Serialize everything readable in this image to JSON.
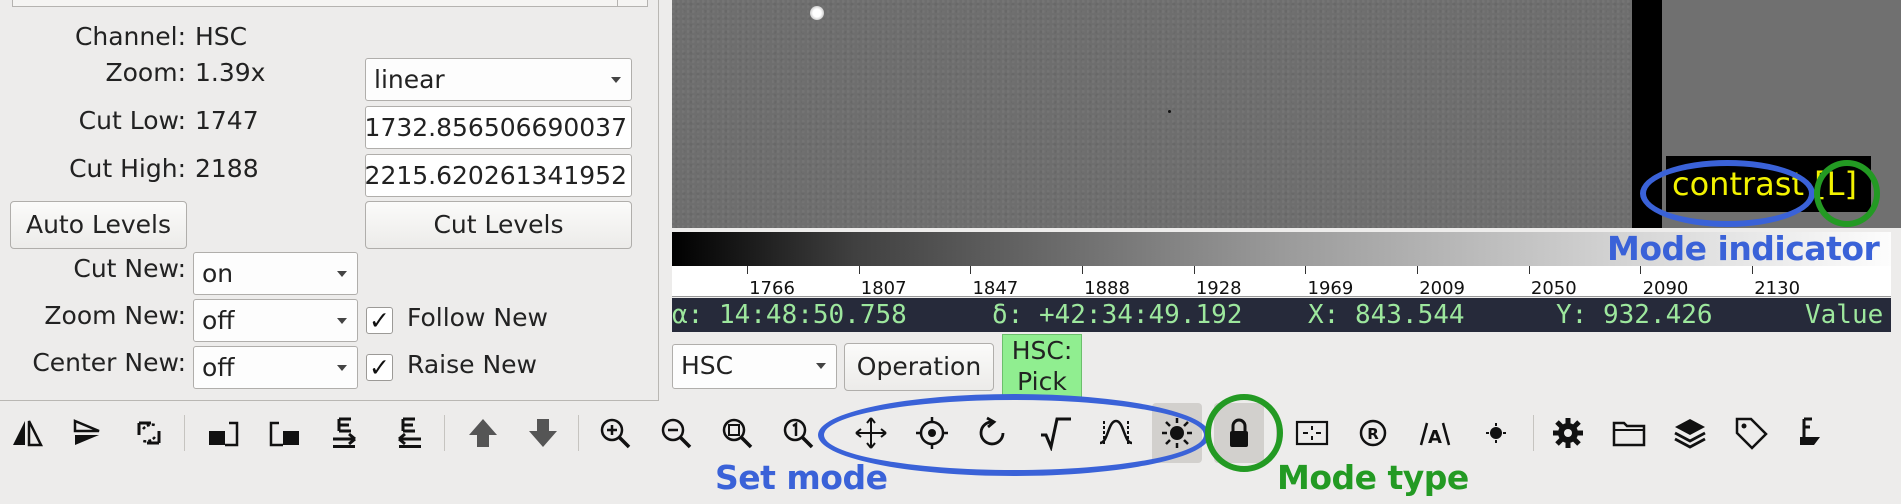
{
  "info_panel": {
    "channel_label": "Channel:",
    "channel_value": "HSC",
    "zoom_label": "Zoom:",
    "zoom_value": "1.39x",
    "zoom_mode": "linear",
    "cut_low_label": "Cut Low:",
    "cut_low_value": "1747",
    "cut_low_entry": "1732.856506690037",
    "cut_high_label": "Cut High:",
    "cut_high_value": "2188",
    "cut_high_entry": "2215.620261341952",
    "auto_levels_label": "Auto Levels",
    "cut_levels_label": "Cut Levels",
    "cut_new_label": "Cut New:",
    "cut_new_value": "on",
    "zoom_new_label": "Zoom New:",
    "zoom_new_value": "off",
    "center_new_label": "Center New:",
    "center_new_value": "off",
    "follow_new_label": "Follow New",
    "follow_new_checked": true,
    "raise_new_label": "Raise New",
    "raise_new_checked": true
  },
  "viewer": {
    "mode_name": "contrast",
    "mode_type": "[L]"
  },
  "colorbar": {
    "ticks": [
      "1766",
      "1807",
      "1847",
      "1888",
      "1928",
      "1969",
      "2009",
      "2050",
      "2090",
      "2130"
    ]
  },
  "status": {
    "ra": "α: 14:48:50.758",
    "dec": "δ: +42:34:49.192",
    "x": "X: 843.544",
    "y": "Y: 932.426",
    "value": "Value"
  },
  "channel_bar": {
    "channel": "HSC",
    "operation_label": "Operation",
    "pick_line1": "HSC:",
    "pick_line2": "Pick"
  },
  "toolbar": {
    "icons": [
      "flip-x-icon",
      "flip-y-icon",
      "swap-xy-icon",
      "rotate-90-icon",
      "rotate-neg-90-icon",
      "orient-north-icon",
      "orient-east-icon",
      "prev-image-icon",
      "next-image-icon",
      "zoom-in-icon",
      "zoom-out-icon",
      "zoom-fit-icon",
      "zoom-100-icon",
      "pan-mode-icon",
      "center-mode-icon",
      "rotate-mode-icon",
      "distribution-mode-icon",
      "cuts-mode-icon",
      "contrast-mode-icon",
      "lock-mode-icon",
      "crosshair-icon",
      "reset-rotation-icon",
      "auto-cuts-icon",
      "auto-center-icon",
      "preferences-icon",
      "open-file-icon",
      "layers-icon",
      "tag-icon",
      "plot-icon"
    ],
    "active_mode": "contrast"
  },
  "annotations": {
    "mode_indicator": "Mode indicator",
    "set_mode": "Set mode",
    "mode_type": "Mode type",
    "blue_color": "#3a62d8",
    "green_color": "#239a23"
  }
}
